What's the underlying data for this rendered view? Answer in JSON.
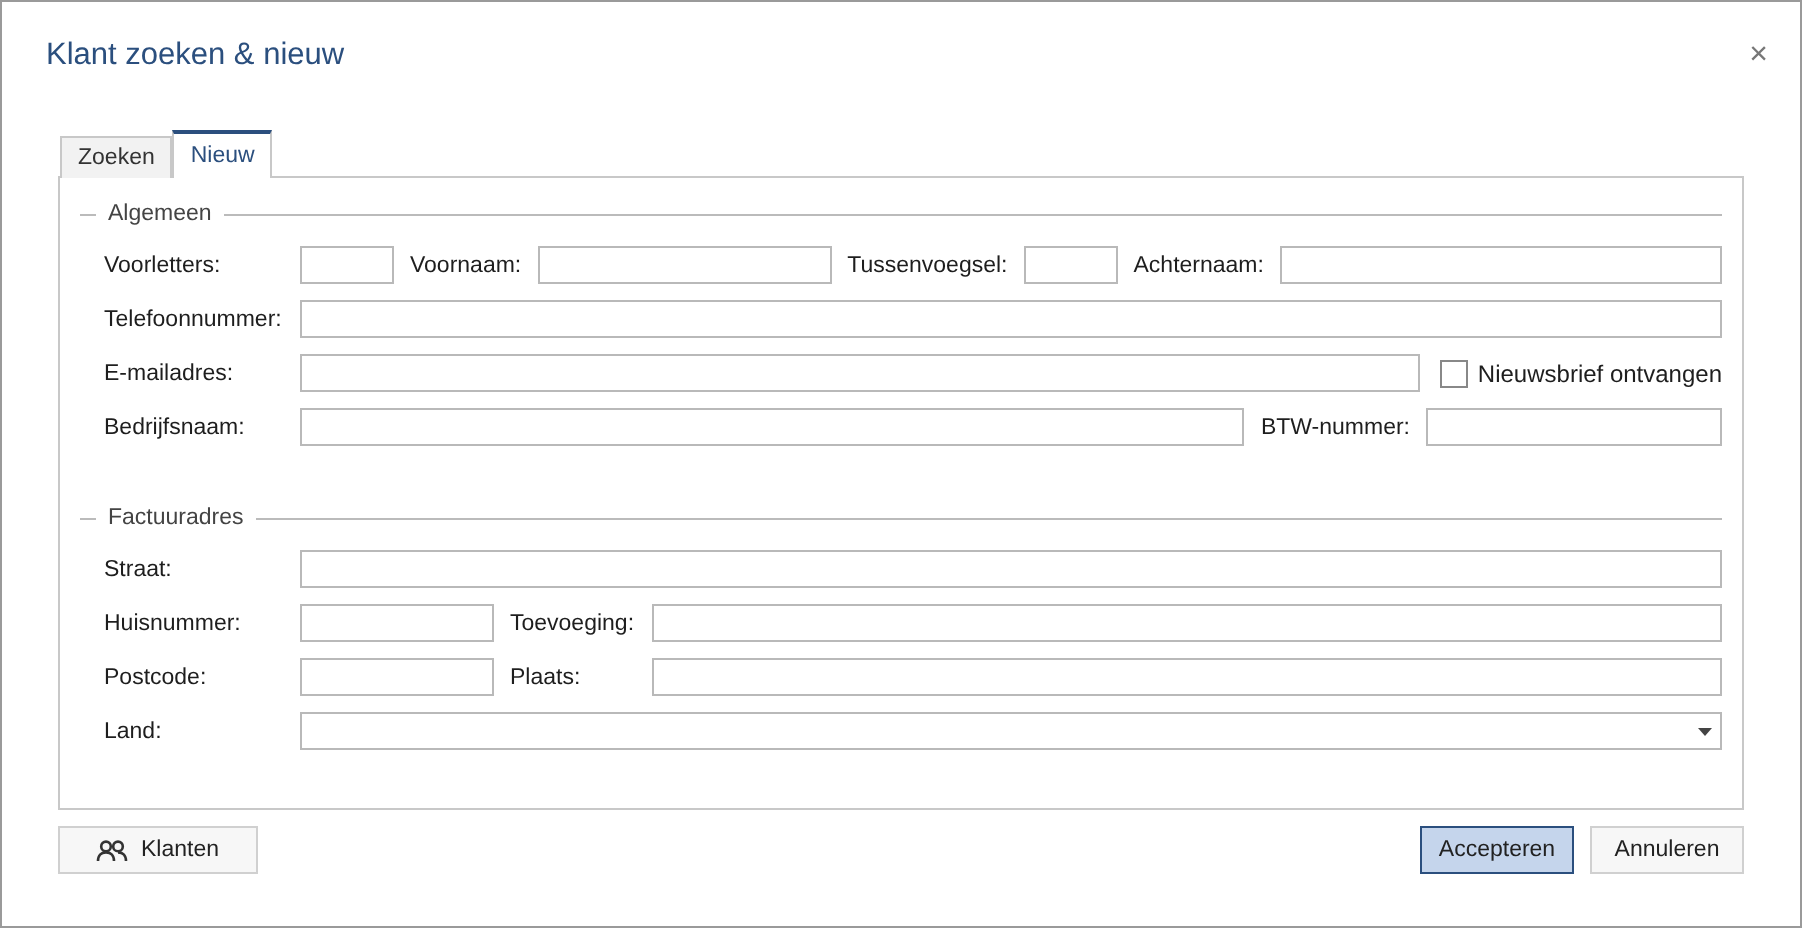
{
  "window": {
    "title": "Klant zoeken & nieuw",
    "close": "×"
  },
  "tabs": [
    {
      "label": "Zoeken",
      "selected": false
    },
    {
      "label": "Nieuw",
      "selected": true
    }
  ],
  "sections": [
    {
      "title": "Algemeen",
      "rows": [
        {
          "fields": [
            {
              "kind": "text",
              "label": "Voorletters:"
            },
            {
              "kind": "text",
              "label": "Voornaam:"
            },
            {
              "kind": "text",
              "label": "Tussenvoegsel:"
            },
            {
              "kind": "text",
              "label": "Achternaam:"
            }
          ]
        },
        {
          "fields": [
            {
              "kind": "text",
              "label": "Telefoonnummer:"
            }
          ]
        },
        {
          "fields": [
            {
              "kind": "text",
              "label": "E-mailadres:"
            },
            {
              "kind": "checkbox",
              "label": "Nieuwsbrief ontvangen",
              "checked": false
            }
          ]
        },
        {
          "fields": [
            {
              "kind": "text",
              "label": "Bedrijfsnaam:"
            },
            {
              "kind": "text",
              "label": "BTW-nummer:"
            }
          ]
        }
      ]
    },
    {
      "title": "Factuuradres",
      "rows": [
        {
          "fields": [
            {
              "kind": "text",
              "label": "Straat:"
            }
          ]
        },
        {
          "fields": [
            {
              "kind": "text",
              "label": "Huisnummer:"
            },
            {
              "kind": "text",
              "label": "Toevoeging:"
            }
          ]
        },
        {
          "fields": [
            {
              "kind": "text",
              "label": "Postcode:"
            },
            {
              "kind": "text",
              "label": "Plaats:"
            }
          ]
        },
        {
          "fields": [
            {
              "kind": "select",
              "label": "Land:"
            }
          ]
        }
      ]
    }
  ],
  "buttons": [
    {
      "label": "Klanten",
      "kind": "people",
      "default": false
    },
    {
      "label": "Accepteren",
      "kind": "plain",
      "default": true
    },
    {
      "label": "Annuleren",
      "kind": "plain",
      "default": false
    }
  ]
}
